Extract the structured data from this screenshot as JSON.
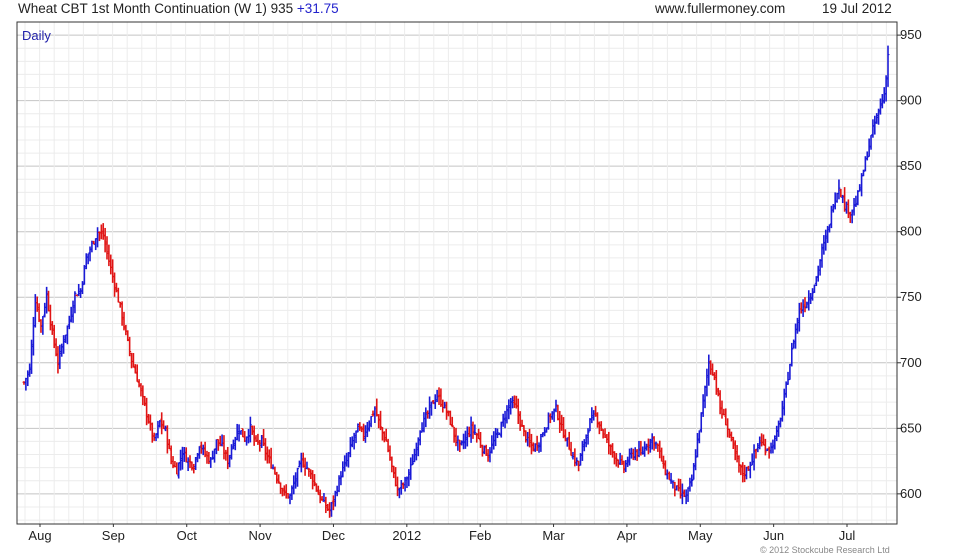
{
  "header": {
    "title": "Wheat CBT 1st Month Continuation (W 1)",
    "last": "935",
    "change": "+31.75",
    "site": "www.fullermoney.com",
    "date": "19 Jul 2012"
  },
  "frequency": "Daily",
  "copyright": "© 2012 Stockcube Research Ltd",
  "colors": {
    "up": "#1a1ad6",
    "down": "#e01414",
    "grid": "#d8d8d8",
    "frame": "#333333"
  },
  "chart_data": {
    "type": "ohlc",
    "ylim": [
      577,
      960
    ],
    "yticks": [
      600,
      650,
      700,
      750,
      800,
      850,
      900,
      950
    ],
    "grid": true,
    "x_labels": [
      "Aug",
      "Sep",
      "Oct",
      "Nov",
      "Dec",
      "2012",
      "Feb",
      "Mar",
      "Apr",
      "May",
      "Jun",
      "Jul"
    ],
    "close_series": [
      [
        0,
        685
      ],
      [
        3,
        695
      ],
      [
        6,
        748
      ],
      [
        9,
        728
      ],
      [
        12,
        752
      ],
      [
        15,
        722
      ],
      [
        18,
        700
      ],
      [
        21,
        718
      ],
      [
        24,
        732
      ],
      [
        27,
        752
      ],
      [
        30,
        755
      ],
      [
        33,
        780
      ],
      [
        36,
        790
      ],
      [
        39,
        800
      ],
      [
        42,
        797
      ],
      [
        45,
        778
      ],
      [
        48,
        760
      ],
      [
        51,
        742
      ],
      [
        54,
        722
      ],
      [
        57,
        702
      ],
      [
        60,
        688
      ],
      [
        63,
        672
      ],
      [
        66,
        656
      ],
      [
        69,
        640
      ],
      [
        72,
        655
      ],
      [
        75,
        648
      ],
      [
        78,
        625
      ],
      [
        81,
        618
      ],
      [
        84,
        632
      ],
      [
        87,
        625
      ],
      [
        90,
        622
      ],
      [
        93,
        638
      ],
      [
        96,
        630
      ],
      [
        99,
        625
      ],
      [
        102,
        640
      ],
      [
        105,
        636
      ],
      [
        108,
        625
      ],
      [
        111,
        640
      ],
      [
        114,
        650
      ],
      [
        117,
        642
      ],
      [
        120,
        650
      ],
      [
        123,
        638
      ],
      [
        126,
        640
      ],
      [
        129,
        628
      ],
      [
        132,
        620
      ],
      [
        135,
        610
      ],
      [
        138,
        600
      ],
      [
        141,
        598
      ],
      [
        144,
        612
      ],
      [
        147,
        625
      ],
      [
        150,
        620
      ],
      [
        153,
        612
      ],
      [
        156,
        600
      ],
      [
        159,
        592
      ],
      [
        162,
        587
      ],
      [
        165,
        600
      ],
      [
        168,
        615
      ],
      [
        171,
        625
      ],
      [
        174,
        640
      ],
      [
        177,
        650
      ],
      [
        180,
        645
      ],
      [
        183,
        655
      ],
      [
        186,
        665
      ],
      [
        189,
        650
      ],
      [
        192,
        640
      ],
      [
        195,
        620
      ],
      [
        198,
        603
      ],
      [
        201,
        607
      ],
      [
        204,
        615
      ],
      [
        207,
        630
      ],
      [
        210,
        650
      ],
      [
        213,
        658
      ],
      [
        216,
        668
      ],
      [
        219,
        675
      ],
      [
        222,
        668
      ],
      [
        225,
        660
      ],
      [
        228,
        645
      ],
      [
        231,
        635
      ],
      [
        234,
        642
      ],
      [
        237,
        650
      ],
      [
        240,
        645
      ],
      [
        243,
        635
      ],
      [
        246,
        630
      ],
      [
        249,
        640
      ],
      [
        252,
        648
      ],
      [
        255,
        660
      ],
      [
        258,
        670
      ],
      [
        261,
        665
      ],
      [
        264,
        650
      ],
      [
        267,
        640
      ],
      [
        270,
        635
      ],
      [
        273,
        640
      ],
      [
        276,
        650
      ],
      [
        279,
        660
      ],
      [
        282,
        665
      ],
      [
        285,
        650
      ],
      [
        288,
        640
      ],
      [
        291,
        628
      ],
      [
        294,
        622
      ],
      [
        297,
        640
      ],
      [
        300,
        655
      ],
      [
        303,
        660
      ],
      [
        306,
        650
      ],
      [
        309,
        640
      ],
      [
        312,
        632
      ],
      [
        315,
        625
      ],
      [
        318,
        620
      ],
      [
        321,
        628
      ],
      [
        324,
        632
      ],
      [
        327,
        630
      ],
      [
        330,
        638
      ],
      [
        333,
        642
      ],
      [
        336,
        636
      ],
      [
        339,
        620
      ],
      [
        342,
        612
      ],
      [
        345,
        605
      ],
      [
        348,
        600
      ],
      [
        351,
        598
      ],
      [
        354,
        610
      ],
      [
        357,
        640
      ],
      [
        360,
        670
      ],
      [
        363,
        700
      ],
      [
        366,
        690
      ],
      [
        369,
        665
      ],
      [
        372,
        655
      ],
      [
        375,
        640
      ],
      [
        378,
        625
      ],
      [
        381,
        615
      ],
      [
        384,
        620
      ],
      [
        387,
        630
      ],
      [
        390,
        640
      ],
      [
        393,
        635
      ],
      [
        396,
        635
      ],
      [
        399,
        645
      ],
      [
        402,
        665
      ],
      [
        405,
        690
      ],
      [
        408,
        718
      ],
      [
        411,
        740
      ],
      [
        414,
        745
      ],
      [
        417,
        752
      ],
      [
        420,
        765
      ],
      [
        423,
        785
      ],
      [
        426,
        800
      ],
      [
        429,
        822
      ],
      [
        432,
        835
      ],
      [
        435,
        820
      ],
      [
        438,
        815
      ],
      [
        441,
        822
      ],
      [
        444,
        840
      ],
      [
        447,
        860
      ],
      [
        450,
        878
      ],
      [
        453,
        892
      ],
      [
        456,
        905
      ],
      [
        458,
        935
      ]
    ]
  }
}
